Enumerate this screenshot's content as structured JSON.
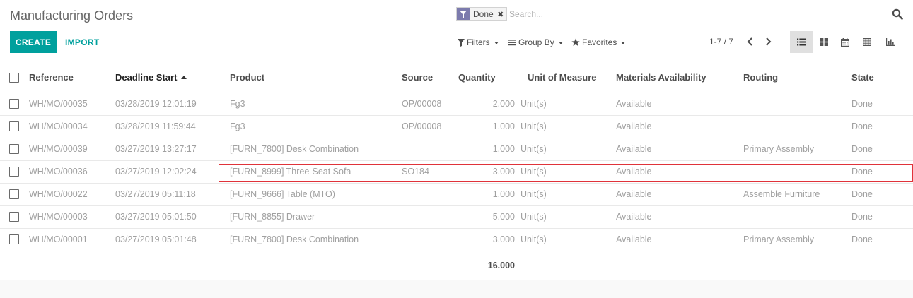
{
  "page": {
    "title": "Manufacturing Orders"
  },
  "buttons": {
    "create": "CREATE",
    "import": "IMPORT"
  },
  "search": {
    "facet_value": "Done",
    "facet_remove": "✖",
    "placeholder": "Search..."
  },
  "filters": {
    "filters_label": "Filters",
    "groupby_label": "Group By",
    "favorites_label": "Favorites"
  },
  "pager": {
    "value": "1-7 / 7"
  },
  "table": {
    "headers": {
      "reference": "Reference",
      "deadline": "Deadline Start",
      "product": "Product",
      "source": "Source",
      "quantity": "Quantity",
      "uom": "Unit of Measure",
      "availability": "Materials Availability",
      "routing": "Routing",
      "state": "State"
    },
    "rows": [
      {
        "reference": "WH/MO/00035",
        "deadline": "03/28/2019 12:01:19",
        "product": "Fg3",
        "source": "OP/00008",
        "quantity": "2.000",
        "uom": "Unit(s)",
        "availability": "Available",
        "routing": "",
        "state": "Done"
      },
      {
        "reference": "WH/MO/00034",
        "deadline": "03/28/2019 11:59:44",
        "product": "Fg3",
        "source": "OP/00008",
        "quantity": "1.000",
        "uom": "Unit(s)",
        "availability": "Available",
        "routing": "",
        "state": "Done"
      },
      {
        "reference": "WH/MO/00039",
        "deadline": "03/27/2019 13:27:17",
        "product": "[FURN_7800] Desk Combination",
        "source": "",
        "quantity": "1.000",
        "uom": "Unit(s)",
        "availability": "Available",
        "routing": "Primary Assembly",
        "state": "Done"
      },
      {
        "reference": "WH/MO/00036",
        "deadline": "03/27/2019 12:02:24",
        "product": "[FURN_8999] Three-Seat Sofa",
        "source": "SO184",
        "quantity": "3.000",
        "uom": "Unit(s)",
        "availability": "Available",
        "routing": "",
        "state": "Done"
      },
      {
        "reference": "WH/MO/00022",
        "deadline": "03/27/2019 05:11:18",
        "product": "[FURN_9666] Table (MTO)",
        "source": "",
        "quantity": "1.000",
        "uom": "Unit(s)",
        "availability": "Available",
        "routing": "Assemble Furniture",
        "state": "Done"
      },
      {
        "reference": "WH/MO/00003",
        "deadline": "03/27/2019 05:01:50",
        "product": "[FURN_8855] Drawer",
        "source": "",
        "quantity": "5.000",
        "uom": "Unit(s)",
        "availability": "Available",
        "routing": "",
        "state": "Done"
      },
      {
        "reference": "WH/MO/00001",
        "deadline": "03/27/2019 05:01:48",
        "product": "[FURN_7800] Desk Combination",
        "source": "",
        "quantity": "3.000",
        "uom": "Unit(s)",
        "availability": "Available",
        "routing": "Primary Assembly",
        "state": "Done"
      }
    ],
    "footer": {
      "quantity_total": "16.000"
    }
  },
  "colors": {
    "accent": "#00a09d",
    "facet_icon": "#7c7bad",
    "highlight": "#e0333a"
  },
  "icons": {
    "facet": "filter-icon",
    "search": "search-icon",
    "filters": "filter-icon",
    "groupby": "bars-icon",
    "favorites": "star-icon",
    "views": [
      "list-view-icon",
      "kanban-view-icon",
      "calendar-view-icon",
      "pivot-view-icon",
      "graph-view-icon"
    ]
  }
}
